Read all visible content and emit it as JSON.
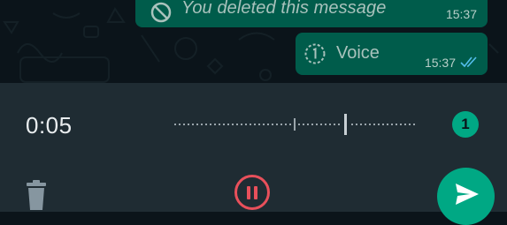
{
  "messages": {
    "deleted": {
      "text": "You deleted this message",
      "time": "15:37"
    },
    "voice": {
      "label": "Voice",
      "time": "15:37",
      "status_icon": "double-check-icon"
    }
  },
  "recorder": {
    "elapsed": "0:05",
    "recording_count": "1",
    "controls": {
      "delete_icon": "trash-icon",
      "pause_icon": "pause-icon",
      "send_icon": "send-icon"
    }
  },
  "colors": {
    "chat_bg": "#0b141a",
    "bubble_out": "#005c4b",
    "panel_bg": "#1f2c33",
    "accent": "#00a884",
    "pause_red": "#e8505b",
    "read_ticks": "#53bdeb"
  }
}
